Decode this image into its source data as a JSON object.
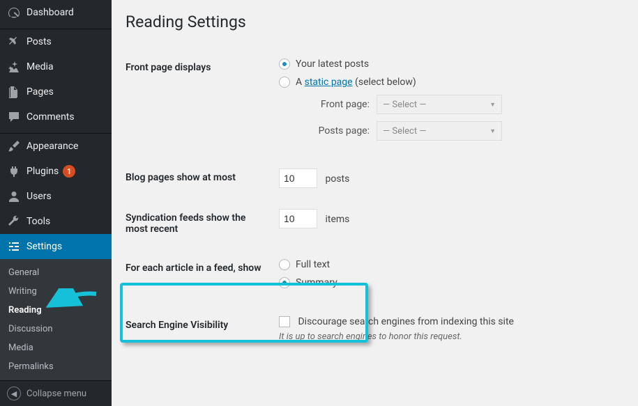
{
  "sidebar": {
    "dashboard": "Dashboard",
    "posts": "Posts",
    "media": "Media",
    "pages": "Pages",
    "comments": "Comments",
    "appearance": "Appearance",
    "plugins": "Plugins",
    "plugins_badge": "1",
    "users": "Users",
    "tools": "Tools",
    "settings": "Settings",
    "submenu": {
      "general": "General",
      "writing": "Writing",
      "reading": "Reading",
      "discussion": "Discussion",
      "media": "Media",
      "permalinks": "Permalinks"
    },
    "collapse": "Collapse menu"
  },
  "page": {
    "title": "Reading Settings",
    "front_page_displays": {
      "label": "Front page displays",
      "opt_latest": "Your latest posts",
      "opt_static_prefix": "A ",
      "opt_static_link": "static page",
      "opt_static_suffix": " (select below)",
      "front_page_label": "Front page:",
      "posts_page_label": "Posts page:",
      "select_placeholder": "— Select —"
    },
    "blog_pages": {
      "label": "Blog pages show at most",
      "value": "10",
      "suffix": "posts"
    },
    "syndication": {
      "label": "Syndication feeds show the most recent",
      "value": "10",
      "suffix": "items"
    },
    "feed_content": {
      "label": "For each article in a feed, show",
      "opt_full": "Full text",
      "opt_summary": "Summary"
    },
    "search_visibility": {
      "label": "Search Engine Visibility",
      "checkbox_label": "Discourage search engines from indexing this site",
      "desc": "It is up to search engines to honor this request."
    }
  }
}
